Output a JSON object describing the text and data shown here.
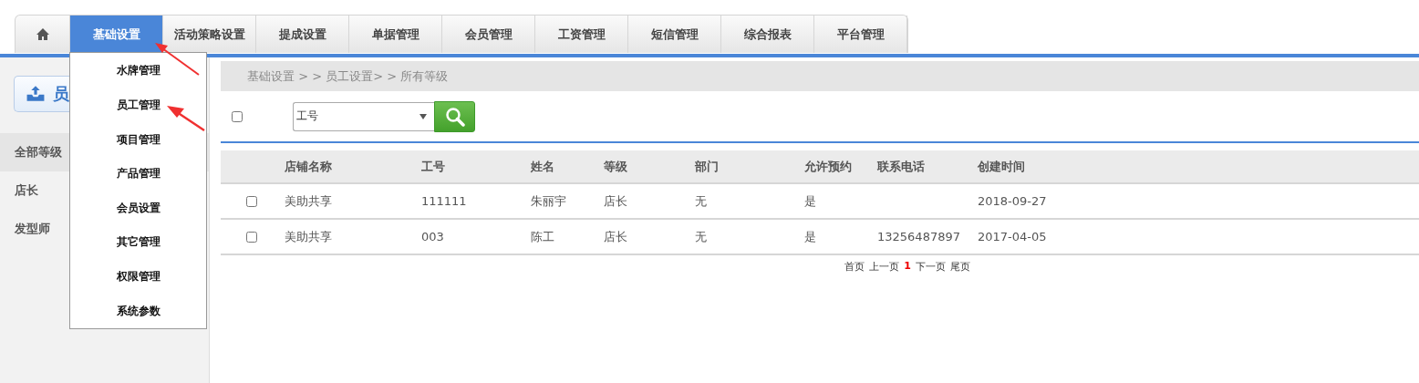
{
  "nav": {
    "tabs": [
      {
        "kind": "home",
        "selected": false
      },
      {
        "label": "基础设置",
        "selected": true
      },
      {
        "label": "活动策略设置",
        "selected": false
      },
      {
        "label": "提成设置",
        "selected": false
      },
      {
        "label": "单据管理",
        "selected": false
      },
      {
        "label": "会员管理",
        "selected": false
      },
      {
        "label": "工资管理",
        "selected": false
      },
      {
        "label": "短信管理",
        "selected": false
      },
      {
        "label": "综合报表",
        "selected": false
      },
      {
        "label": "平台管理",
        "selected": false
      }
    ]
  },
  "dropdown": {
    "items": [
      "水牌管理",
      "员工管理",
      "项目管理",
      "产品管理",
      "会员设置",
      "其它管理",
      "权限管理",
      "系统参数"
    ]
  },
  "sidebar": {
    "button": "员",
    "items": [
      {
        "label": "全部等级",
        "selected": true
      },
      {
        "label": "店长",
        "selected": false
      },
      {
        "label": "发型师",
        "selected": false
      }
    ]
  },
  "breadcrumb": "基础设置 > > 员工设置> > 所有等级",
  "toolbar": {
    "select_all": false,
    "select_value": "工号"
  },
  "table": {
    "columns": [
      "店铺名称",
      "工号",
      "姓名",
      "等级",
      "部门",
      "允许预约",
      "联系电话",
      "创建时间"
    ],
    "rows": [
      {
        "checked": false,
        "cells": [
          "美助共享",
          "111111",
          "朱丽宇",
          "店长",
          "无",
          "是",
          "",
          "2018-09-27"
        ]
      },
      {
        "checked": false,
        "cells": [
          "美助共享",
          "003",
          "陈工",
          "店长",
          "无",
          "是",
          "13256487897",
          "2017-04-05"
        ]
      }
    ]
  },
  "pagination": {
    "first": "首页",
    "prev": "上一页",
    "current": "1",
    "next": "下一页",
    "last": "尾页"
  }
}
